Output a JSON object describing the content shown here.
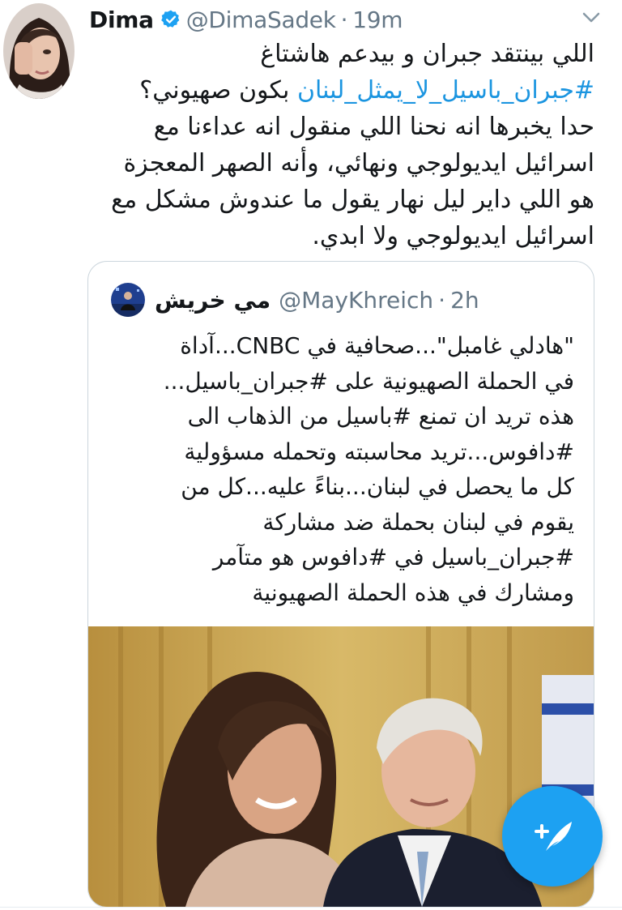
{
  "tweet": {
    "display_name": "Dima",
    "verified_icon": "verified-badge-icon",
    "handle": "@DimaSadek",
    "separator": "·",
    "time": "19m",
    "body_line_1": "اللي بينتقد جبران و بيدعم هاشتاغ",
    "body_hashtag": "#جبران_باسيل_لا_يمثل_لبنان",
    "body_line_2_rest": " بكون صهيوني؟",
    "body_line_3": "حدا يخبرها انه نحنا اللي منقول انه عداءنا مع",
    "body_line_4": "اسرائيل ايديولوجي ونهائي، وأنه الصهر المعجزة",
    "body_line_5": "هو اللي داير ليل نهار يقول ما عندوش مشكل مع",
    "body_line_6": "اسرائيل ايديولوجي ولا ابدي."
  },
  "quoted_tweet": {
    "display_name": "مي خريش",
    "handle": "@MayKhreich",
    "separator": "·",
    "time": "2h",
    "lines": [
      "\"هادلي غامبل\"...صحافية في CNBC...آداة",
      "في الحملة الصهيونية على #جبران_باسيل...",
      "هذه تريد ان تمنع #باسيل من الذهاب الى",
      "#دافوس...تريد محاسبته وتحمله مسؤولية",
      "كل ما يحصل في لبنان...بناءً عليه...كل من",
      "يقوم في لبنان بحملة ضد مشاركة",
      "#جبران_باسيل في #دافوس هو متآمر",
      "ومشارك في هذه الحملة الصهيونية"
    ]
  },
  "icons": {
    "caret": "chevron-down-icon",
    "compose": "compose-tweet-icon"
  },
  "colors": {
    "link": "#1b95e0",
    "accent": "#1da1f2",
    "secondary_text": "#657786",
    "border": "#ccd6dd"
  }
}
